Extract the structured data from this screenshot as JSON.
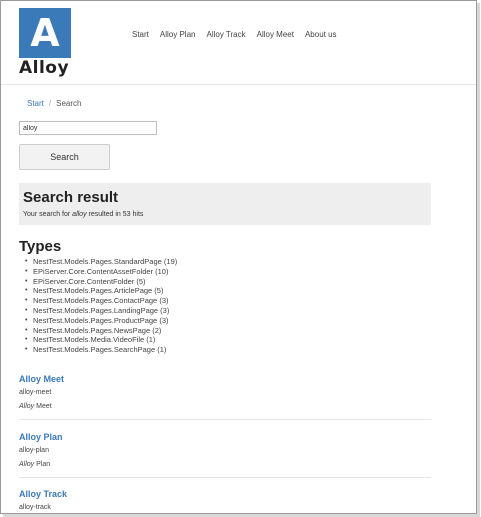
{
  "logo": {
    "letter": "A",
    "word": "Alloy"
  },
  "nav": [
    "Start",
    "Alloy Plan",
    "Alloy Track",
    "Alloy Meet",
    "About us"
  ],
  "breadcrumb": {
    "home": "Start",
    "separator": "/",
    "current": "Search"
  },
  "search": {
    "value": "alloy",
    "button_label": "Search"
  },
  "result": {
    "title": "Search result",
    "prefix": "Your search for ",
    "query": "alloy",
    "suffix": " resulted in 53 hits"
  },
  "types": {
    "title": "Types",
    "items": [
      "NestTest.Models.Pages.StandardPage (19)",
      "EPiServer.Core.ContentAssetFolder (10)",
      "EPiServer.Core.ContentFolder (5)",
      "NestTest.Models.Pages.ArticlePage (5)",
      "NestTest.Models.Pages.ContactPage (3)",
      "NestTest.Models.Pages.LandingPage (3)",
      "NestTest.Models.Pages.ProductPage (3)",
      "NestTest.Models.Pages.NewsPage (2)",
      "NestTest.Models.Media.VideoFile (1)",
      "NestTest.Models.Pages.SearchPage (1)"
    ]
  },
  "hits": [
    {
      "title": "Alloy Meet",
      "url": "alloy-meet",
      "desc_prefix": "Alloy",
      "desc_rest": " Meet"
    },
    {
      "title": "Alloy Plan",
      "url": "alloy-plan",
      "desc_prefix": "Alloy",
      "desc_rest": " Plan"
    },
    {
      "title": "Alloy Track",
      "url": "alloy-track",
      "desc_prefix": "",
      "desc_rest": ""
    }
  ],
  "colors": {
    "brand": "#3a7ab8",
    "result_bg": "#eeeeee"
  }
}
